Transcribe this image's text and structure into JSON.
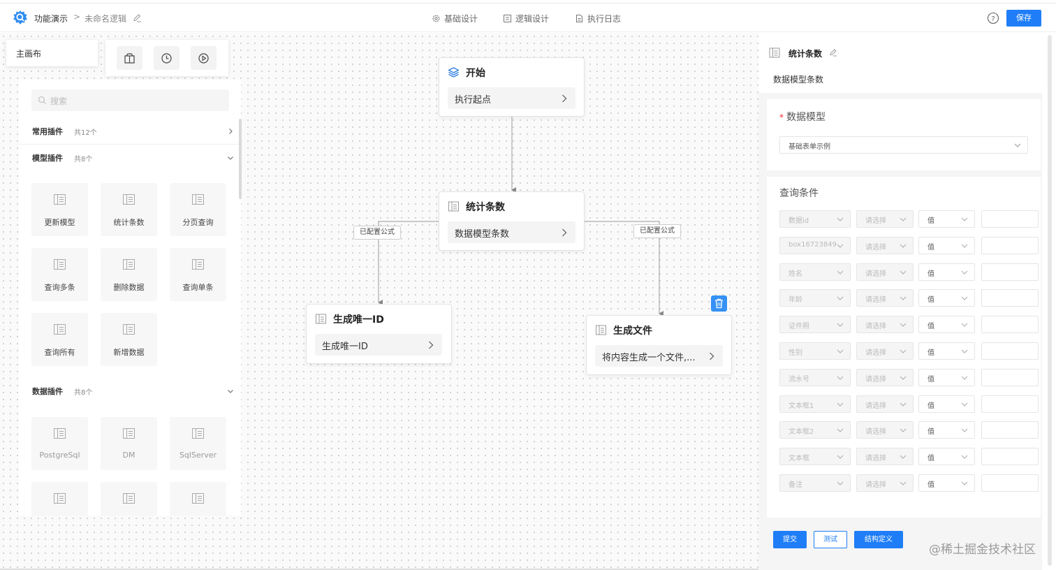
{
  "header": {
    "app_title": "功能演示",
    "separator": ">",
    "logic_name": "未命名逻辑",
    "tabs": [
      {
        "label": "基础设计",
        "icon": "gear-icon"
      },
      {
        "label": "逻辑设计",
        "icon": "logic-icon"
      },
      {
        "label": "执行日志",
        "icon": "document-icon"
      }
    ],
    "save_label": "保存",
    "accent_color": "#1f7ef7"
  },
  "canvas": {
    "tab_label": "主画布",
    "toolbar": [
      "package-icon",
      "clock-icon",
      "play-icon"
    ]
  },
  "plugins": {
    "search_placeholder": "搜索",
    "sections": [
      {
        "title": "常用插件",
        "count": "共12个",
        "expanded": false
      },
      {
        "title": "模型插件",
        "count": "共8个",
        "expanded": true
      },
      {
        "title": "数据插件",
        "count": "共8个",
        "expanded": true
      }
    ],
    "model_items": [
      "更新模型",
      "统计条数",
      "分页查询",
      "查询多条",
      "删除数据",
      "查询单条",
      "查询所有",
      "新增数据"
    ],
    "data_items": [
      "PostgreSql",
      "DM",
      "SqlServer",
      "",
      "",
      ""
    ]
  },
  "flow": {
    "nodes": {
      "start": {
        "title": "开始",
        "body": "执行起点"
      },
      "count": {
        "title": "统计条数",
        "body": "数据模型条数"
      },
      "uid": {
        "title": "生成唯一ID",
        "body": "生成唯一ID"
      },
      "file": {
        "title": "生成文件",
        "body": "将内容生成一个文件,..."
      }
    },
    "edge_labels": [
      "已配置公式",
      "已配置公式"
    ]
  },
  "panel": {
    "title": "统计条数",
    "description": "数据模型条数",
    "model_label": "数据模型",
    "model_value": "基础表单示例",
    "query_label": "查询条件",
    "query_rows": [
      {
        "field": "数据id",
        "op": "请选择",
        "type": "值"
      },
      {
        "field": "box16723849",
        "op": "请选择",
        "type": "值"
      },
      {
        "field": "姓名",
        "op": "请选择",
        "type": "值"
      },
      {
        "field": "年龄",
        "op": "请选择",
        "type": "值"
      },
      {
        "field": "证件照",
        "op": "请选择",
        "type": "值"
      },
      {
        "field": "性别",
        "op": "请选择",
        "type": "值"
      },
      {
        "field": "流水号",
        "op": "请选择",
        "type": "值"
      },
      {
        "field": "文本框1",
        "op": "请选择",
        "type": "值"
      },
      {
        "field": "文本框2",
        "op": "请选择",
        "type": "值"
      },
      {
        "field": "文本框",
        "op": "请选择",
        "type": "值"
      },
      {
        "field": "备注",
        "op": "请选择",
        "type": "值"
      }
    ],
    "buttons": {
      "submit": "提交",
      "test": "测试",
      "structure": "结构定义"
    }
  },
  "watermark": "@稀土掘金技术社区"
}
